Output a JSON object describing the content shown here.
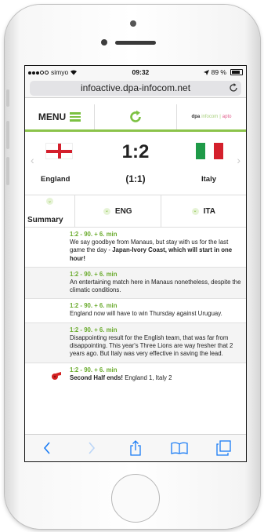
{
  "status": {
    "carrier": "simyo",
    "time": "09:32",
    "battery": "89 %"
  },
  "browser": {
    "url": "infoactive.dpa-infocom.net"
  },
  "header": {
    "menu_label": "MENU",
    "logo_main": "dpa",
    "logo_sub": "infocom",
    "logo_sep": "|",
    "logo_alt": "apto"
  },
  "match": {
    "home": "England",
    "away": "Italy",
    "score": "1:2",
    "halftime": "(1:1)"
  },
  "tabs": {
    "summary": "Summary",
    "home": "ENG",
    "away": "ITA"
  },
  "ticker": [
    {
      "time": "1:2 - 90. + 6. min",
      "text_plain": "We say goodbye from Manaus, but stay with us for the last game the day - ",
      "text_bold": "Japan-Ivory Coast, which will start in one hour!"
    },
    {
      "time": "1:2 - 90. + 6. min",
      "text_plain": "An entertaining match here in Manaus nonetheless, despite the climatic conditions."
    },
    {
      "time": "1:2 - 90. + 6. min",
      "text_plain": "England now will have to win Thursday against Uruguay."
    },
    {
      "time": "1:2 - 90. + 6. min",
      "text_plain": "Disappointing result for the English team, that was far from disappointing. This year's Three Lions are way fresher that 2 years ago. But Italy was very effective in saving the lead."
    },
    {
      "time": "1:2 - 90. + 6. min",
      "text_bold_lead": "Second Half ends!",
      "text_plain": " England 1, Italy 2"
    }
  ],
  "colors": {
    "accent": "#8bc34a",
    "ios_blue": "#1a7cf5"
  }
}
